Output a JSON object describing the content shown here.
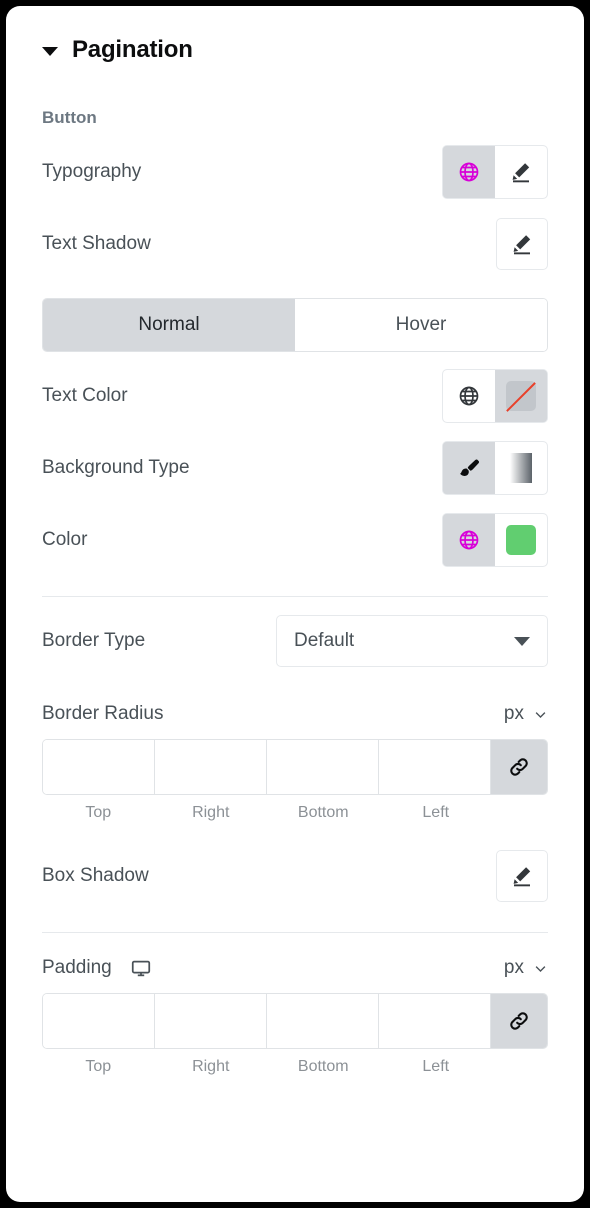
{
  "panel": {
    "section": {
      "title": "Pagination",
      "collapse_icon": "caret-down-icon"
    },
    "subheading": "Button"
  },
  "rows": {
    "typography": {
      "label": "Typography",
      "globe_icon": "globe-icon",
      "edit_icon": "pencil-icon"
    },
    "text_shadow": {
      "label": "Text Shadow",
      "edit_icon": "pencil-icon"
    },
    "text_color": {
      "label": "Text Color",
      "globe_icon": "globe-icon",
      "swatch_icon": "no-color-swatch-icon"
    },
    "background_type": {
      "label": "Background Type",
      "classic_icon": "paint-brush-icon",
      "gradient_icon": "gradient-icon"
    },
    "color": {
      "label": "Color",
      "globe_icon": "globe-icon",
      "swatch_color": "#61ce70"
    },
    "border_type": {
      "label": "Border Type",
      "value": "Default",
      "options": [
        "Default"
      ],
      "caret_icon": "caret-down-icon"
    },
    "border_radius": {
      "label": "Border Radius",
      "unit": "px",
      "unit_caret_icon": "chevron-down-icon",
      "link_icon": "link-icon",
      "values": [
        "",
        "",
        "",
        ""
      ],
      "captions": [
        "Top",
        "Right",
        "Bottom",
        "Left"
      ]
    },
    "box_shadow": {
      "label": "Box Shadow",
      "edit_icon": "pencil-icon"
    },
    "padding": {
      "label": "Padding",
      "device_icon": "desktop-icon",
      "unit": "px",
      "unit_caret_icon": "chevron-down-icon",
      "link_icon": "link-icon",
      "values": [
        "",
        "",
        "",
        ""
      ],
      "captions": [
        "Top",
        "Right",
        "Bottom",
        "Left"
      ]
    }
  },
  "colors": {
    "globe_active": "#d800d8",
    "globe_inactive": "#33373b",
    "accent_green": "#61ce70",
    "no_color_slash": "#e8402a",
    "control_bg": "#d5d8dc",
    "label_text": "#495157"
  }
}
